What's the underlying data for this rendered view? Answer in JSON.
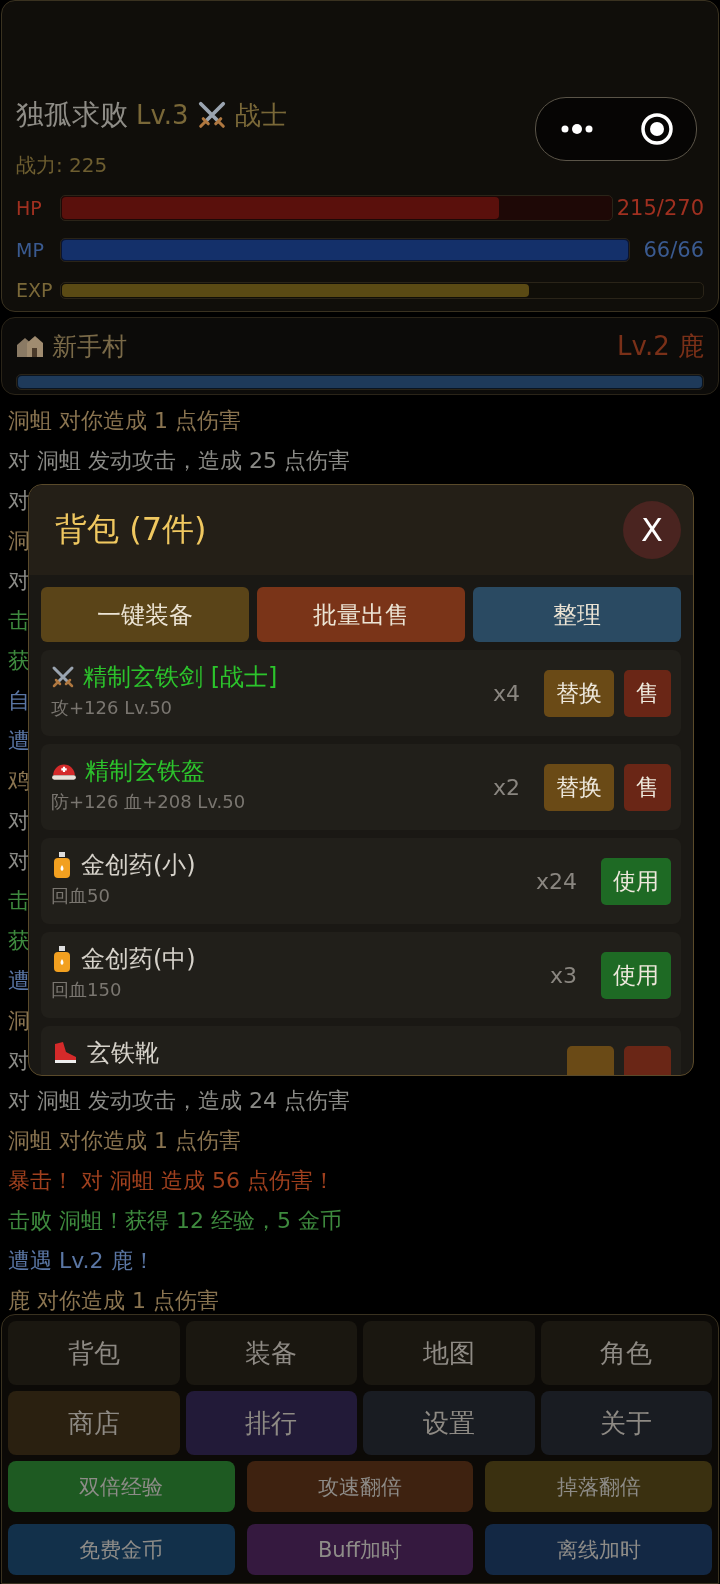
{
  "player": {
    "name": "独孤求败",
    "level": "Lv.3",
    "class": "战士",
    "power": "战力: 225"
  },
  "bars": [
    {
      "kind": "hp",
      "label": "HP",
      "level": 0.796,
      "reading": "215/270"
    },
    {
      "kind": "mp",
      "label": "MP",
      "level": 1,
      "reading": "66/66"
    },
    {
      "kind": "exp",
      "label": "EXP",
      "level": 0.73
    }
  ],
  "location": {
    "name": "新手村",
    "enemy": "Lv.2 鹿",
    "level": 1
  },
  "log": [
    {
      "kind": "hurt",
      "text": "洞蛆 对你造成 1 点伤害"
    },
    {
      "kind": "attack",
      "text": "对 洞蛆 发动攻击，造成 25 点伤害"
    },
    {
      "kind": "attack",
      "text": "对"
    },
    {
      "kind": "hurt",
      "text": "洞"
    },
    {
      "kind": "attack",
      "text": "对"
    },
    {
      "kind": "win",
      "text": "击"
    },
    {
      "kind": "win",
      "text": "获"
    },
    {
      "kind": "encounter",
      "text": "自"
    },
    {
      "kind": "encounter",
      "text": "遭"
    },
    {
      "kind": "hurt",
      "text": "鸡"
    },
    {
      "kind": "attack",
      "text": "对"
    },
    {
      "kind": "attack",
      "text": "对"
    },
    {
      "kind": "win",
      "text": "击"
    },
    {
      "kind": "win",
      "text": "获"
    },
    {
      "kind": "encounter",
      "text": "遭"
    },
    {
      "kind": "hurt",
      "text": "洞"
    },
    {
      "kind": "attack",
      "text": "对"
    },
    {
      "kind": "attack",
      "text": "对 洞蛆 发动攻击，造成 24 点伤害"
    },
    {
      "kind": "hurt",
      "text": "洞蛆 对你造成 1 点伤害"
    },
    {
      "kind": "crit",
      "text": "暴击！ 对 洞蛆 造成 56 点伤害！"
    },
    {
      "kind": "win",
      "text": "击败 洞蛆！获得 12 经验，5 金币"
    },
    {
      "kind": "encounter",
      "text": "遭遇 Lv.2 鹿！"
    },
    {
      "kind": "hurt",
      "text": "鹿 对你造成 1 点伤害"
    }
  ],
  "bag": {
    "title": "背包 (7件)",
    "close": "X",
    "actions": [
      {
        "kind": "equip",
        "label": "一键装备"
      },
      {
        "kind": "sell",
        "label": "批量出售"
      },
      {
        "kind": "sort",
        "label": "整理"
      }
    ],
    "items": [
      {
        "kind": "sword",
        "rare": true,
        "name": "精制玄铁剑 [战士]",
        "stats": "攻+126 Lv.50",
        "count": "x4",
        "buttons": [
          {
            "kind": "swap",
            "label": "替换"
          },
          {
            "kind": "sell",
            "label": "售"
          }
        ]
      },
      {
        "kind": "helmet",
        "rare": true,
        "name": "精制玄铁盔",
        "stats": "防+126 血+208 Lv.50",
        "count": "x2",
        "buttons": [
          {
            "kind": "swap",
            "label": "替换"
          },
          {
            "kind": "sell",
            "label": "售"
          }
        ]
      },
      {
        "kind": "potion",
        "rare": false,
        "name": "金创药(小)",
        "stats": "回血50",
        "count": "x24",
        "buttons": [
          {
            "kind": "use",
            "label": "使用"
          }
        ]
      },
      {
        "kind": "potion",
        "rare": false,
        "name": "金创药(中)",
        "stats": "回血150",
        "count": "x3",
        "buttons": [
          {
            "kind": "use",
            "label": "使用"
          }
        ]
      },
      {
        "kind": "boots",
        "rare": false,
        "name": "玄铁靴",
        "buttons": [
          {
            "kind": "swap"
          },
          {
            "kind": "sell"
          }
        ]
      }
    ]
  },
  "menu": [
    {
      "kind": "plain",
      "label": "背包"
    },
    {
      "kind": "plain",
      "label": "装备"
    },
    {
      "kind": "plain",
      "label": "地图"
    },
    {
      "kind": "plain",
      "label": "角色"
    },
    {
      "kind": "shop",
      "label": "商店"
    },
    {
      "kind": "rank",
      "label": "排行"
    },
    {
      "kind": "cool",
      "label": "设置"
    },
    {
      "kind": "cool",
      "label": "关于"
    }
  ],
  "boosts": [
    {
      "kind": "green",
      "label": "双倍经验"
    },
    {
      "kind": "rust",
      "label": "攻速翻倍"
    },
    {
      "kind": "olive",
      "label": "掉落翻倍"
    },
    {
      "kind": "teal",
      "label": "免费金币"
    },
    {
      "kind": "purple",
      "label": "Buff加时"
    },
    {
      "kind": "navy",
      "label": "离线加时"
    }
  ]
}
